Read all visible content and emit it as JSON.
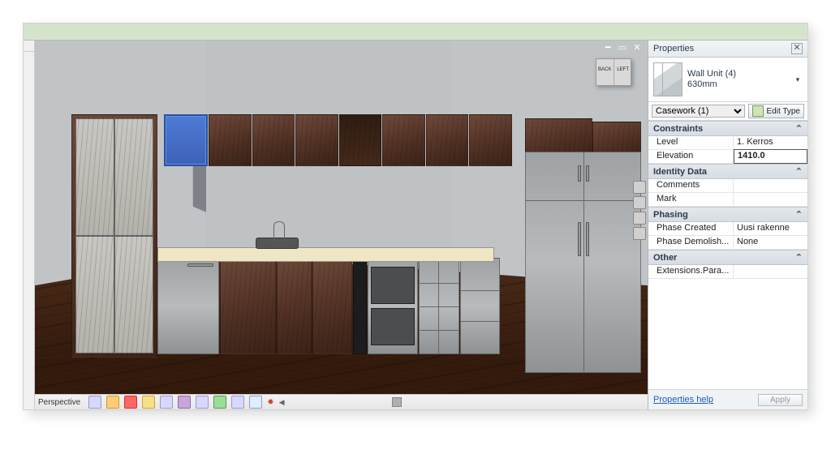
{
  "view": {
    "name": "Perspective",
    "navcube": {
      "face1": "BACK",
      "face2": "LEFT"
    }
  },
  "properties": {
    "panel_title": "Properties",
    "type": {
      "family_label": "Wall Unit (4)",
      "type_label": "630mm"
    },
    "category_selector": "Casework (1)",
    "edit_type_label": "Edit Type",
    "groups": [
      {
        "title": "Constraints",
        "params": [
          {
            "name": "Level",
            "value": "1. Kerros"
          },
          {
            "name": "Elevation",
            "value": "1410.0",
            "highlight": true
          }
        ]
      },
      {
        "title": "Identity Data",
        "params": [
          {
            "name": "Comments",
            "value": ""
          },
          {
            "name": "Mark",
            "value": ""
          }
        ]
      },
      {
        "title": "Phasing",
        "params": [
          {
            "name": "Phase Created",
            "value": "Uusi rakenne"
          },
          {
            "name": "Phase Demolish...",
            "value": "None"
          }
        ]
      },
      {
        "title": "Other",
        "params": [
          {
            "name": "Extensions.Para...",
            "value": ""
          }
        ]
      }
    ],
    "footer": {
      "help_label": "Properties help",
      "apply_label": "Apply"
    }
  }
}
